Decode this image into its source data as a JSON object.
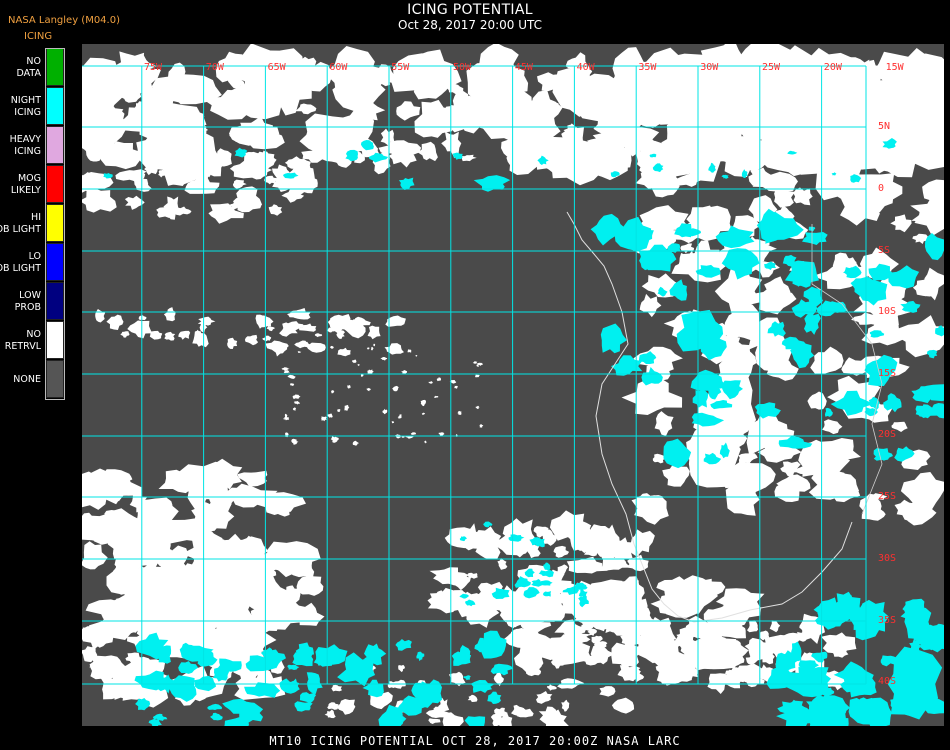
{
  "header": {
    "credit": "NASA Langley (M04.0)",
    "product": "ICING",
    "title": "ICING POTENTIAL",
    "datetime": "Oct 28, 2017 20:00 UTC"
  },
  "legend": [
    {
      "label": "NO DATA",
      "color": "#00b000"
    },
    {
      "label": "NIGHT ICING",
      "color": "#00ffff"
    },
    {
      "label": "HEAVY ICING",
      "color": "#e0a8e0"
    },
    {
      "label": "MOG LIKELY",
      "color": "#ff0000"
    },
    {
      "label": "HI PROB LIGHT",
      "color": "#ffff00"
    },
    {
      "label": "LO PROB LIGHT",
      "color": "#0000ff"
    },
    {
      "label": "LOW PROB",
      "color": "#000080"
    },
    {
      "label": "NO RETRVL",
      "color": "#ffffff"
    },
    {
      "label": "NONE",
      "color": "#555555"
    }
  ],
  "map": {
    "background_color": "#4a4a4a",
    "grid_color": "#00e5e5",
    "label_color": "#ff3030",
    "lon_labels": [
      "75W",
      "70W",
      "65W",
      "60W",
      "55W",
      "50W",
      "45W",
      "40W",
      "35W",
      "30W",
      "25W",
      "20W",
      "15W"
    ],
    "lat_labels": [
      "5N",
      "0",
      "5S",
      "10S",
      "15S",
      "20S",
      "25S",
      "30S",
      "35S",
      "40S"
    ]
  },
  "footer": {
    "text": "MT10  ICING POTENTIAL   OCT 28, 2017 20:00Z   NASA LARC"
  }
}
